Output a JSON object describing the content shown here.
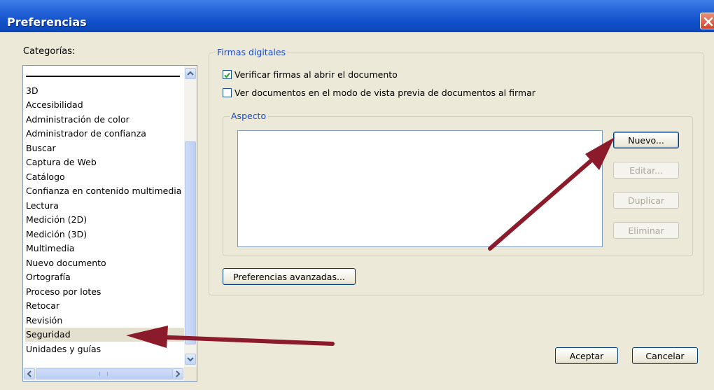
{
  "window": {
    "title": "Preferencias"
  },
  "categories": {
    "label": "Categorías:",
    "items": [
      {
        "label": "3D"
      },
      {
        "label": "Accesibilidad"
      },
      {
        "label": "Administración de color"
      },
      {
        "label": "Administrador de confianza"
      },
      {
        "label": "Buscar"
      },
      {
        "label": "Captura de Web"
      },
      {
        "label": "Catálogo"
      },
      {
        "label": "Confianza en contenido multimedia"
      },
      {
        "label": "Lectura"
      },
      {
        "label": "Medición (2D)"
      },
      {
        "label": "Medición (3D)"
      },
      {
        "label": "Multimedia"
      },
      {
        "label": "Nuevo documento"
      },
      {
        "label": "Ortografía"
      },
      {
        "label": "Proceso por lotes"
      },
      {
        "label": "Retocar"
      },
      {
        "label": "Revisión"
      },
      {
        "label": "Seguridad"
      },
      {
        "label": "Unidades y guías"
      }
    ],
    "selected": "Seguridad"
  },
  "firmas": {
    "legend": "Firmas digitales",
    "verify_label": "Verificar firmas al abrir el documento",
    "verify_checked": true,
    "preview_label": "Ver documentos en el modo de vista previa de documentos al firmar",
    "preview_checked": false
  },
  "aspecto": {
    "legend": "Aspecto",
    "new_label": "Nuevo...",
    "edit_label": "Editar...",
    "duplicate_label": "Duplicar",
    "delete_label": "Eliminar"
  },
  "advanced_label": "Preferencias avanzadas...",
  "footer": {
    "ok_label": "Aceptar",
    "cancel_label": "Cancelar"
  },
  "colors": {
    "titlebar": "#0f4fc8",
    "accent_legend": "#1a4ac8",
    "annotation_arrow": "#8b1a2a"
  }
}
